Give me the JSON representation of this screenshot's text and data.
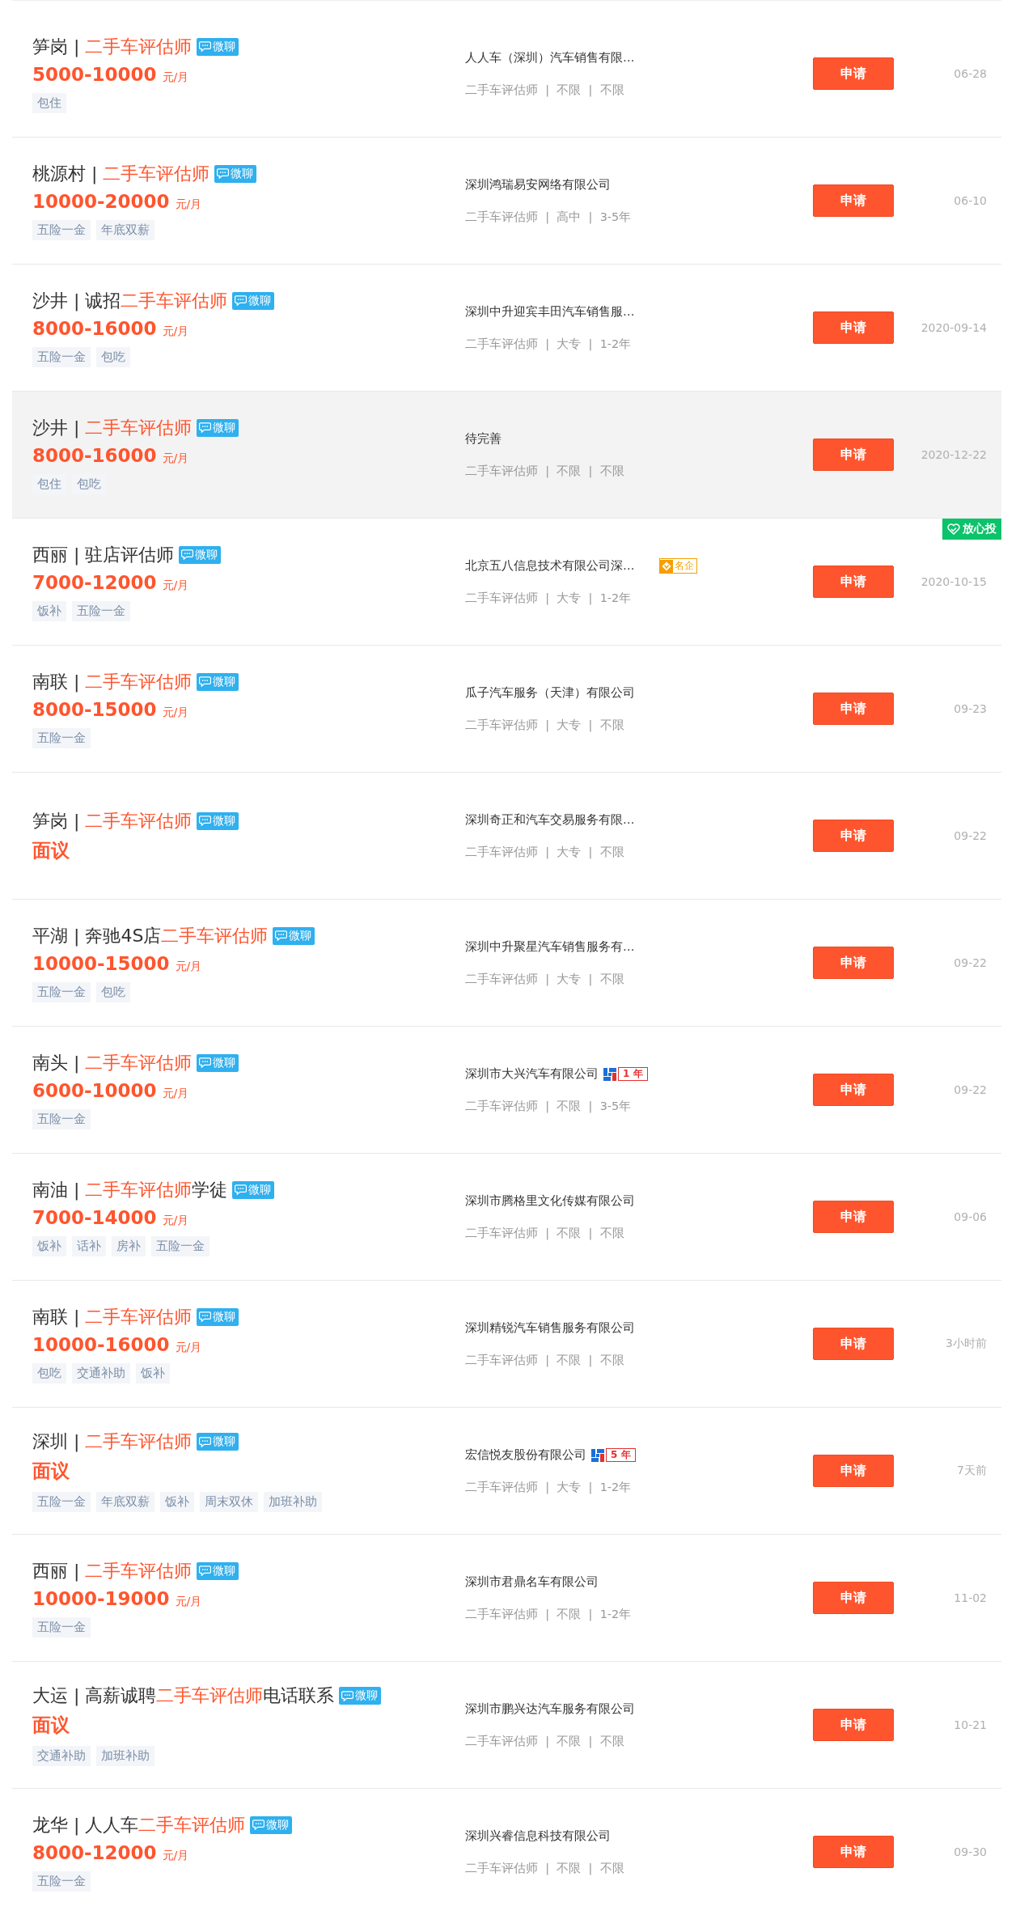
{
  "jobs": [
    {
      "title_parts": [
        {
          "text": "笋岗 | ",
          "highlight": false
        },
        {
          "text": "二手车评估师",
          "highlight": true
        }
      ],
      "chat_badge": "微聊",
      "salary": {
        "amount": "5000-10000",
        "unit": "元/月"
      },
      "tags": [
        "包住"
      ],
      "company": "人人车（深圳）汽车销售有限…",
      "meta": "二手车评估师  |  不限  |  不限",
      "apply": "申请",
      "date": "06-28",
      "hovered": false
    },
    {
      "title_parts": [
        {
          "text": "桃源村 | ",
          "highlight": false
        },
        {
          "text": "二手车评估师",
          "highlight": true
        }
      ],
      "chat_badge": "微聊",
      "salary": {
        "amount": "10000-20000",
        "unit": "元/月"
      },
      "tags": [
        "五险一金",
        "年底双薪"
      ],
      "company": "深圳鸿瑞易安网络有限公司",
      "meta": "二手车评估师  |  高中  |  3-5年",
      "apply": "申请",
      "date": "06-10",
      "hovered": false
    },
    {
      "title_parts": [
        {
          "text": "沙井 | 诚招",
          "highlight": false
        },
        {
          "text": "二手车评估师",
          "highlight": true
        }
      ],
      "chat_badge": "微聊",
      "salary": {
        "amount": "8000-16000",
        "unit": "元/月"
      },
      "tags": [
        "五险一金",
        "包吃"
      ],
      "company": "深圳中升迎宾丰田汽车销售服…",
      "meta": "二手车评估师  |  大专  |  1-2年",
      "apply": "申请",
      "date": "2020-09-14",
      "hovered": false
    },
    {
      "title_parts": [
        {
          "text": "沙井 | ",
          "highlight": false
        },
        {
          "text": "二手车评估师",
          "highlight": true
        }
      ],
      "chat_badge": "微聊",
      "salary": {
        "amount": "8000-16000",
        "unit": "元/月"
      },
      "tags": [
        "包住",
        "包吃"
      ],
      "company": "待完善",
      "meta": "二手车评估师  |  不限  |  不限",
      "apply": "申请",
      "date": "2020-12-22",
      "hovered": true
    },
    {
      "title_parts": [
        {
          "text": "西丽 | 驻店评估师",
          "highlight": false
        }
      ],
      "chat_badge": "微聊",
      "salary": {
        "amount": "7000-12000",
        "unit": "元/月"
      },
      "tags": [
        "饭补",
        "五险一金"
      ],
      "company": "北京五八信息技术有限公司深…",
      "company_badge": {
        "kind": "famous",
        "text": "名企"
      },
      "meta": "二手车评估师  |  大专  |  1-2年",
      "apply": "申请",
      "date": "2020-10-15",
      "hovered": false,
      "corner_badge": "放心投"
    },
    {
      "title_parts": [
        {
          "text": "南联 | ",
          "highlight": false
        },
        {
          "text": "二手车评估师",
          "highlight": true
        }
      ],
      "chat_badge": "微聊",
      "salary": {
        "amount": "8000-15000",
        "unit": "元/月"
      },
      "tags": [
        "五险一金"
      ],
      "company": "瓜子汽车服务（天津）有限公司",
      "meta": "二手车评估师  |  大专  |  不限",
      "apply": "申请",
      "date": "09-23",
      "hovered": false
    },
    {
      "title_parts": [
        {
          "text": "笋岗 | ",
          "highlight": false
        },
        {
          "text": "二手车评估师",
          "highlight": true
        }
      ],
      "chat_badge": "微聊",
      "salary": {
        "amount": "面议"
      },
      "company": "深圳奇正和汽车交易服务有限…",
      "meta": "二手车评估师  |  大专  |  不限",
      "apply": "申请",
      "date": "09-22",
      "hovered": false
    },
    {
      "title_parts": [
        {
          "text": "平湖 | 奔驰4S店",
          "highlight": false
        },
        {
          "text": "二手车评估师",
          "highlight": true
        }
      ],
      "chat_badge": "微聊",
      "salary": {
        "amount": "10000-15000",
        "unit": "元/月"
      },
      "tags": [
        "五险一金",
        "包吃"
      ],
      "company": "深圳中升聚星汽车销售服务有…",
      "meta": "二手车评估师  |  大专  |  不限",
      "apply": "申请",
      "date": "09-22",
      "hovered": false
    },
    {
      "title_parts": [
        {
          "text": "南头 | ",
          "highlight": false
        },
        {
          "text": "二手车评估师",
          "highlight": true
        }
      ],
      "chat_badge": "微聊",
      "salary": {
        "amount": "6000-10000",
        "unit": "元/月"
      },
      "tags": [
        "五险一金"
      ],
      "company": "深圳市大兴汽车有限公司",
      "company_badge": {
        "kind": "years",
        "text": "1 年"
      },
      "meta": "二手车评估师  |  不限  |  3-5年",
      "apply": "申请",
      "date": "09-22",
      "hovered": false
    },
    {
      "title_parts": [
        {
          "text": "南油 | ",
          "highlight": false
        },
        {
          "text": "二手车评估师",
          "highlight": true
        },
        {
          "text": "学徒",
          "highlight": false
        }
      ],
      "chat_badge": "微聊",
      "salary": {
        "amount": "7000-14000",
        "unit": "元/月"
      },
      "tags": [
        "饭补",
        "话补",
        "房补",
        "五险一金"
      ],
      "company": "深圳市腾格里文化传媒有限公司",
      "meta": "二手车评估师  |  不限  |  不限",
      "apply": "申请",
      "date": "09-06",
      "hovered": false
    },
    {
      "title_parts": [
        {
          "text": "南联 | ",
          "highlight": false
        },
        {
          "text": "二手车评估师",
          "highlight": true
        }
      ],
      "chat_badge": "微聊",
      "salary": {
        "amount": "10000-16000",
        "unit": "元/月"
      },
      "tags": [
        "包吃",
        "交通补助",
        "饭补"
      ],
      "company": "深圳精锐汽车销售服务有限公司",
      "meta": "二手车评估师  |  不限  |  不限",
      "apply": "申请",
      "date": "3小时前",
      "hovered": false
    },
    {
      "title_parts": [
        {
          "text": "深圳 | ",
          "highlight": false
        },
        {
          "text": "二手车评估师",
          "highlight": true
        }
      ],
      "chat_badge": "微聊",
      "salary": {
        "amount": "面议"
      },
      "tags": [
        "五险一金",
        "年底双薪",
        "饭补",
        "周末双休",
        "加班补助"
      ],
      "company": "宏信悦友股份有限公司",
      "company_badge": {
        "kind": "years",
        "text": "5 年"
      },
      "meta": "二手车评估师  |  大专  |  1-2年",
      "apply": "申请",
      "date": "7天前",
      "hovered": false
    },
    {
      "title_parts": [
        {
          "text": "西丽 | ",
          "highlight": false
        },
        {
          "text": "二手车评估师",
          "highlight": true
        }
      ],
      "chat_badge": "微聊",
      "salary": {
        "amount": "10000-19000",
        "unit": "元/月"
      },
      "tags": [
        "五险一金"
      ],
      "company": "深圳市君鼎名车有限公司",
      "meta": "二手车评估师  |  不限  |  1-2年",
      "apply": "申请",
      "date": "11-02",
      "hovered": false
    },
    {
      "title_parts": [
        {
          "text": "大运 | 高薪诚聘",
          "highlight": false
        },
        {
          "text": "二手车评估师",
          "highlight": true
        },
        {
          "text": "电话联系",
          "highlight": false
        }
      ],
      "chat_badge": "微聊",
      "salary": {
        "amount": "面议"
      },
      "tags": [
        "交通补助",
        "加班补助"
      ],
      "company": "深圳市鹏兴达汽车服务有限公司",
      "meta": "二手车评估师  |  不限  |  不限",
      "apply": "申请",
      "date": "10-21",
      "hovered": false
    },
    {
      "title_parts": [
        {
          "text": "龙华 | 人人车",
          "highlight": false
        },
        {
          "text": "二手车评估师",
          "highlight": true
        }
      ],
      "chat_badge": "微聊",
      "salary": {
        "amount": "8000-12000",
        "unit": "元/月"
      },
      "tags": [
        "五险一金"
      ],
      "company": "深圳兴睿信息科技有限公司",
      "meta": "二手车评估师  |  不限  |  不限",
      "apply": "申请",
      "date": "09-30",
      "hovered": false
    }
  ]
}
